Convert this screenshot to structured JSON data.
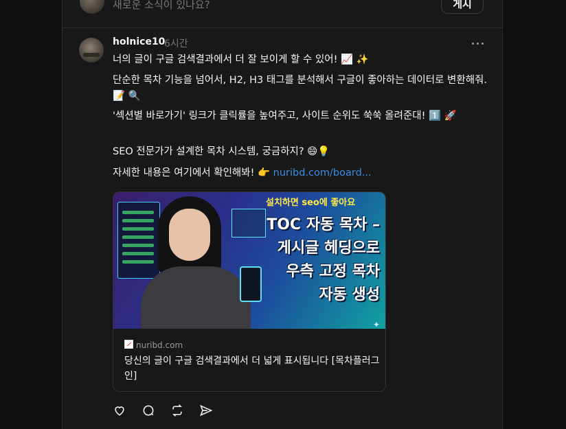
{
  "composer": {
    "placeholder": "새로운 소식이 있나요?",
    "post_label": "게시"
  },
  "post": {
    "username": "holnice10",
    "time": "6시간",
    "paragraphs": [
      "너의 글이 구글 검색결과에서 더 잘 보이게 할 수 있어! 📈 ✨",
      "단순한 목차 기능을 넘어서, H2, H3 태그를 분석해서 구글이 좋아하는 데이터로 변환해줘. 📝 🔍",
      "'섹션별 바로가기' 링크가 클릭률을 높여주고, 사이트 순위도 쑥쑥 올려준대! 1️⃣ 🚀",
      "SEO 전문가가 설계한 목차 시스템, 궁금하지? 😄💡"
    ],
    "last_line_text": "자세한 내용은 여기에서 확인해봐! 👉",
    "link_text": "nuribd.com/board..."
  },
  "card": {
    "image_caption_top": "설치하면 seo에 좋아요",
    "image_lines": [
      "TOC 자동 목차 –",
      "게시글 헤딩으로",
      "우측 고정 목차",
      "자동 생성"
    ],
    "domain": "nuribd.com",
    "title": "당신의 글이 구글 검색결과에서 더 넓게 표시됩니다 [목차플러그인]"
  },
  "actions": [
    "heart-icon",
    "comment-icon",
    "repost-icon",
    "share-icon"
  ],
  "colors": {
    "background": "#101010",
    "panel": "#181818",
    "link": "#3b8ee4",
    "muted": "#777777",
    "caption_yellow": "#ffe84a"
  }
}
